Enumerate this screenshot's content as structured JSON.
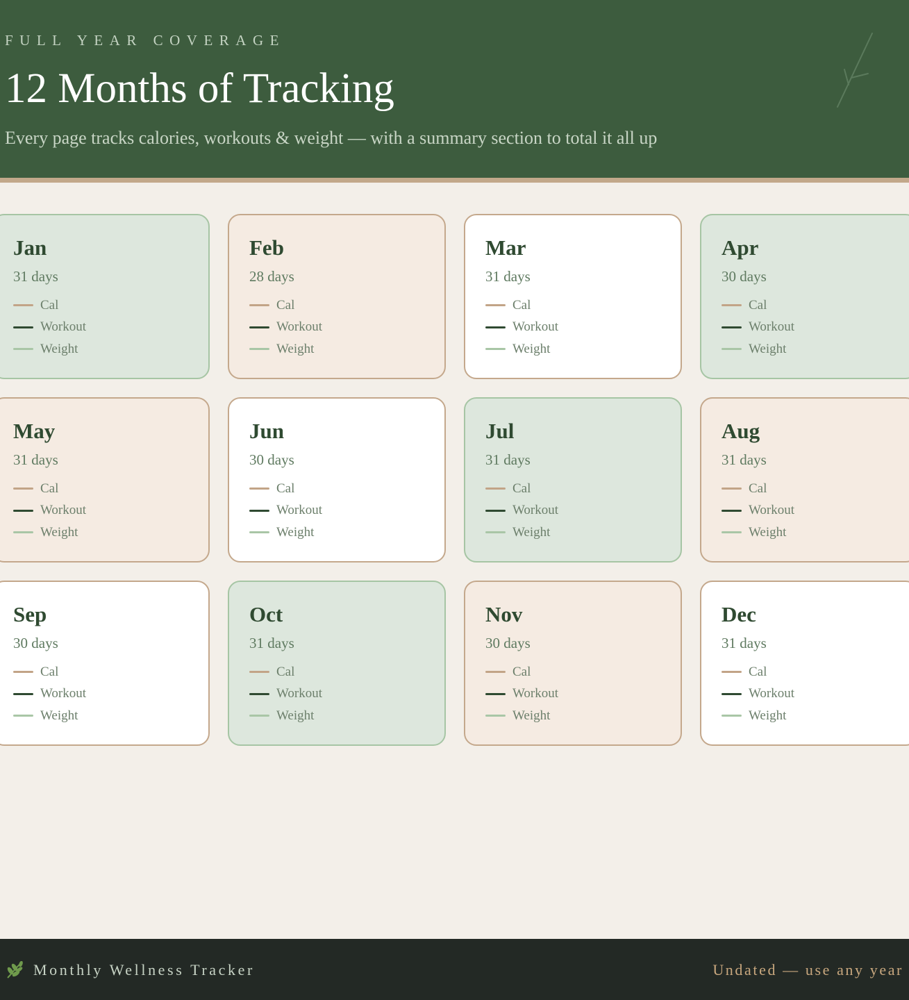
{
  "header": {
    "eyebrow": "FULL YEAR COVERAGE",
    "title": "12 Months of Tracking",
    "subtitle": "Every page tracks calories, workouts & weight — with a summary section to total it all up"
  },
  "legend": {
    "cal": {
      "label": "Cal",
      "color": "#c2a487"
    },
    "workout": {
      "label": "Workout",
      "color": "#2f4a31"
    },
    "weight": {
      "label": "Weight",
      "color": "#a9c6a6"
    }
  },
  "months": [
    {
      "name": "Jan",
      "days": "31 days",
      "theme": "green"
    },
    {
      "name": "Feb",
      "days": "28 days",
      "theme": "peach"
    },
    {
      "name": "Mar",
      "days": "31 days",
      "theme": "white"
    },
    {
      "name": "Apr",
      "days": "30 days",
      "theme": "green"
    },
    {
      "name": "May",
      "days": "31 days",
      "theme": "peach"
    },
    {
      "name": "Jun",
      "days": "30 days",
      "theme": "white"
    },
    {
      "name": "Jul",
      "days": "31 days",
      "theme": "green"
    },
    {
      "name": "Aug",
      "days": "31 days",
      "theme": "peach"
    },
    {
      "name": "Sep",
      "days": "30 days",
      "theme": "white"
    },
    {
      "name": "Oct",
      "days": "31 days",
      "theme": "green"
    },
    {
      "name": "Nov",
      "days": "30 days",
      "theme": "peach"
    },
    {
      "name": "Dec",
      "days": "31 days",
      "theme": "white"
    }
  ],
  "footer": {
    "icon": "leaf-icon",
    "brand": "Monthly Wellness Tracker",
    "note": "Undated — use any year"
  },
  "colors": {
    "header_bg": "#3d5c3e",
    "page_bg": "#f3efe9",
    "footer_bg": "#232925",
    "accent_tan": "#c2a88a"
  }
}
